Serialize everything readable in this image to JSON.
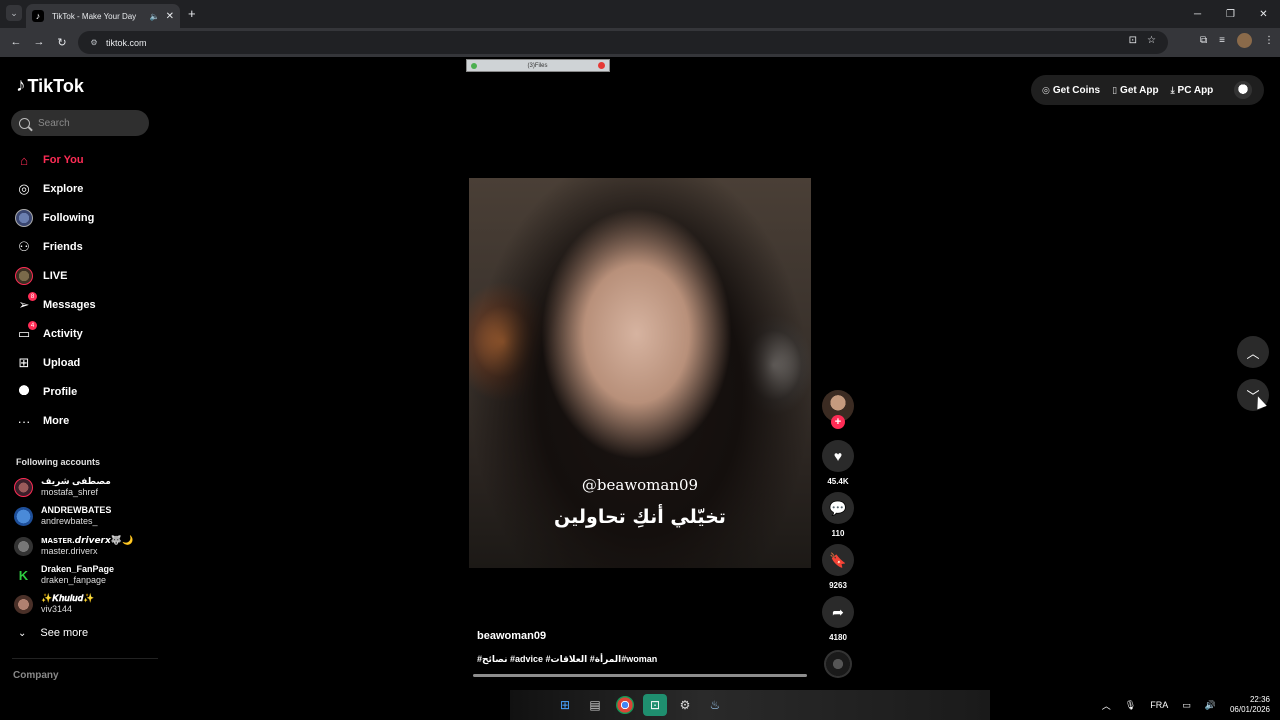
{
  "browser": {
    "tab_title": "TikTok - Make Your Day",
    "new_tab_label": "+",
    "url": "tiktok.com"
  },
  "sidebar": {
    "logo_text": "TikTok",
    "search_placeholder": "Search",
    "nav": [
      {
        "label": "For You",
        "icon": "home-icon",
        "active": true
      },
      {
        "label": "Explore",
        "icon": "compass-icon"
      },
      {
        "label": "Following",
        "icon": "avatar"
      },
      {
        "label": "Friends",
        "icon": "friends-icon"
      },
      {
        "label": "LIVE",
        "icon": "avatar"
      },
      {
        "label": "Messages",
        "icon": "messages-icon",
        "badge": "8"
      },
      {
        "label": "Activity",
        "icon": "activity-icon",
        "badge": "4"
      },
      {
        "label": "Upload",
        "icon": "upload-icon"
      },
      {
        "label": "Profile",
        "icon": "profile-icon"
      },
      {
        "label": "More",
        "icon": "more-icon"
      }
    ],
    "following_title": "Following accounts",
    "accounts": [
      {
        "name": "مصطفى شريف",
        "handle": "mostafa_shref"
      },
      {
        "name": "ANDREWBATES",
        "handle": "andrewbates_"
      },
      {
        "name": "ᴍᴀsᴛᴇʀ.𝙙𝙧𝙞𝙫𝙚𝙧𝙭🐺🌙",
        "handle": "master.driverx"
      },
      {
        "name": "Draken_FanPage",
        "handle": "draken_fanpage"
      },
      {
        "name": "✨𝑲𝒉𝒖𝒍𝒖𝒅✨",
        "handle": "viv3144"
      }
    ],
    "see_more": "See more",
    "company": "Company"
  },
  "top_actions": {
    "get_coins": "Get Coins",
    "get_app": "Get App",
    "pc_app": "PC App"
  },
  "overlay_strip_text": "(3)Files",
  "video": {
    "watermark": "@beawoman09",
    "caption": "تخيّلي أنكِ تحاولين",
    "username": "beawoman09",
    "hashtags": "#نصائح #advice #المرأة# العلاقات#woman"
  },
  "actions": {
    "likes": "45.4K",
    "comments": "110",
    "saves": "9263",
    "shares": "4180"
  },
  "taskbar": {
    "lang": "FRA",
    "time": "22:36",
    "date": "06/01/2026"
  },
  "colors": {
    "accent": "#fe2c55",
    "background": "#000000",
    "chrome_dark": "#202124",
    "chrome_toolbar": "#35363a"
  }
}
